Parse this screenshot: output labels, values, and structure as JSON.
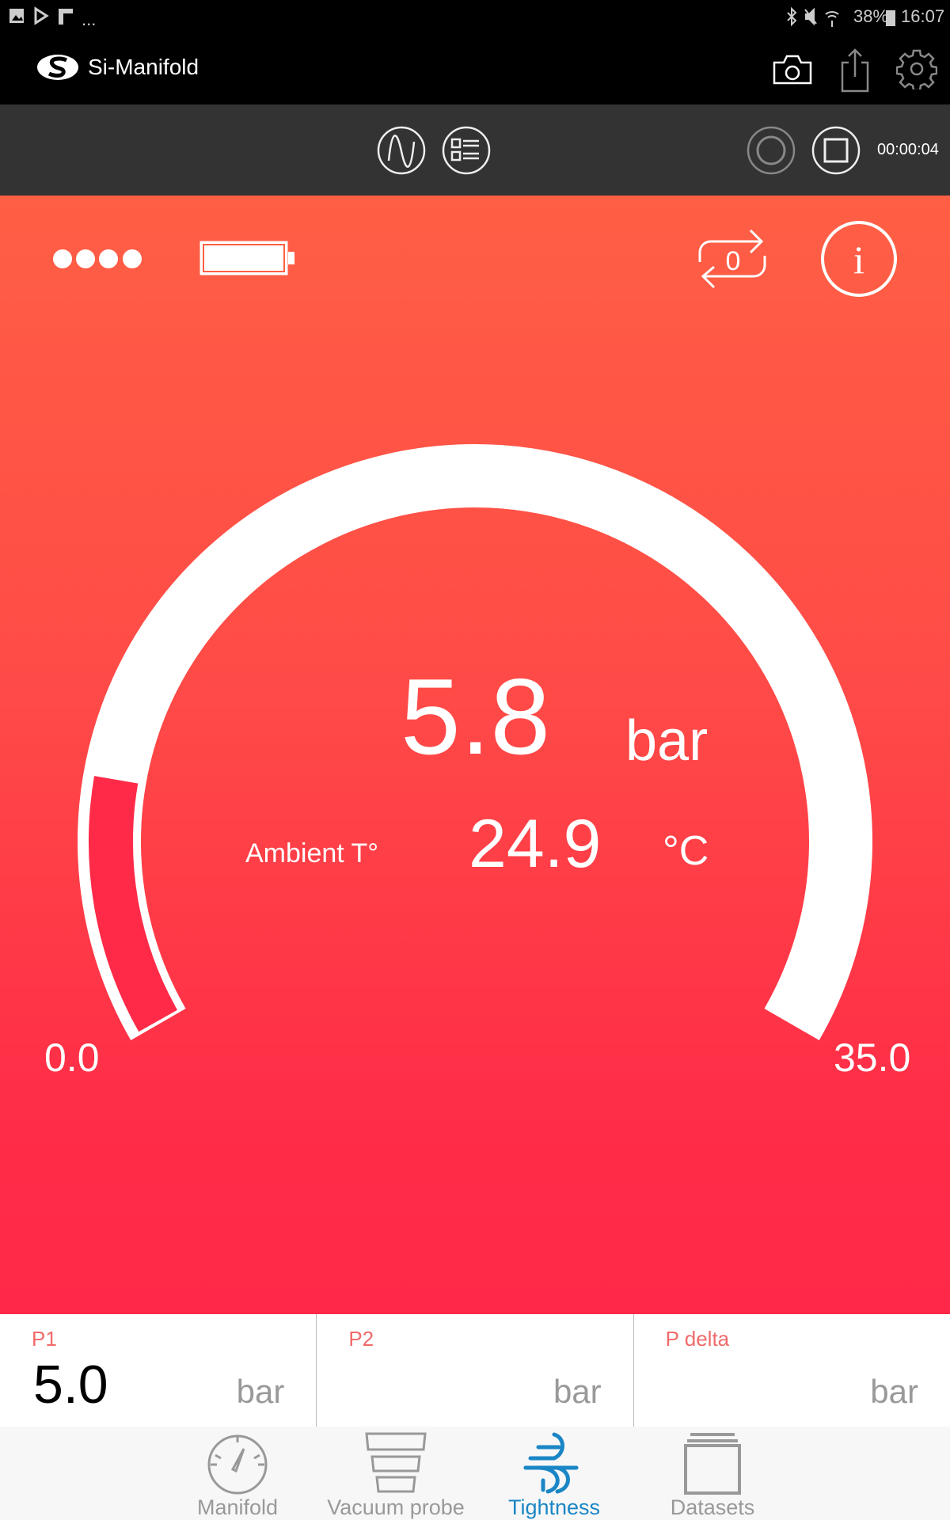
{
  "status_bar": {
    "battery": "38%",
    "time": "16:07",
    "notif_more": "..."
  },
  "app": {
    "title": "Si-Manifold"
  },
  "toolbar": {
    "timer": "00:00:04"
  },
  "gauge": {
    "value": "5.8",
    "value_num": 5.8,
    "unit": "bar",
    "min": "0.0",
    "max": "35.0",
    "min_num": 0,
    "max_num": 35,
    "ambient_label": "Ambient T°",
    "ambient_value": "24.9",
    "ambient_unit": "°C",
    "fill_color": "#ff2a48"
  },
  "cards": [
    {
      "label": "P1",
      "value": "5.0",
      "unit": "bar"
    },
    {
      "label": "P2",
      "value": "",
      "unit": "bar"
    },
    {
      "label": "P delta",
      "value": "",
      "unit": "bar"
    }
  ],
  "nav": [
    {
      "label": "Manifold",
      "icon": "gauge-icon"
    },
    {
      "label": "Vacuum probe",
      "icon": "vacuum-probe-icon"
    },
    {
      "label": "Tightness",
      "icon": "wind-icon",
      "active": true
    },
    {
      "label": "Datasets",
      "icon": "datasets-icon"
    }
  ],
  "colors": {
    "accent": "#1a86c6",
    "label": "#f06a6a"
  }
}
